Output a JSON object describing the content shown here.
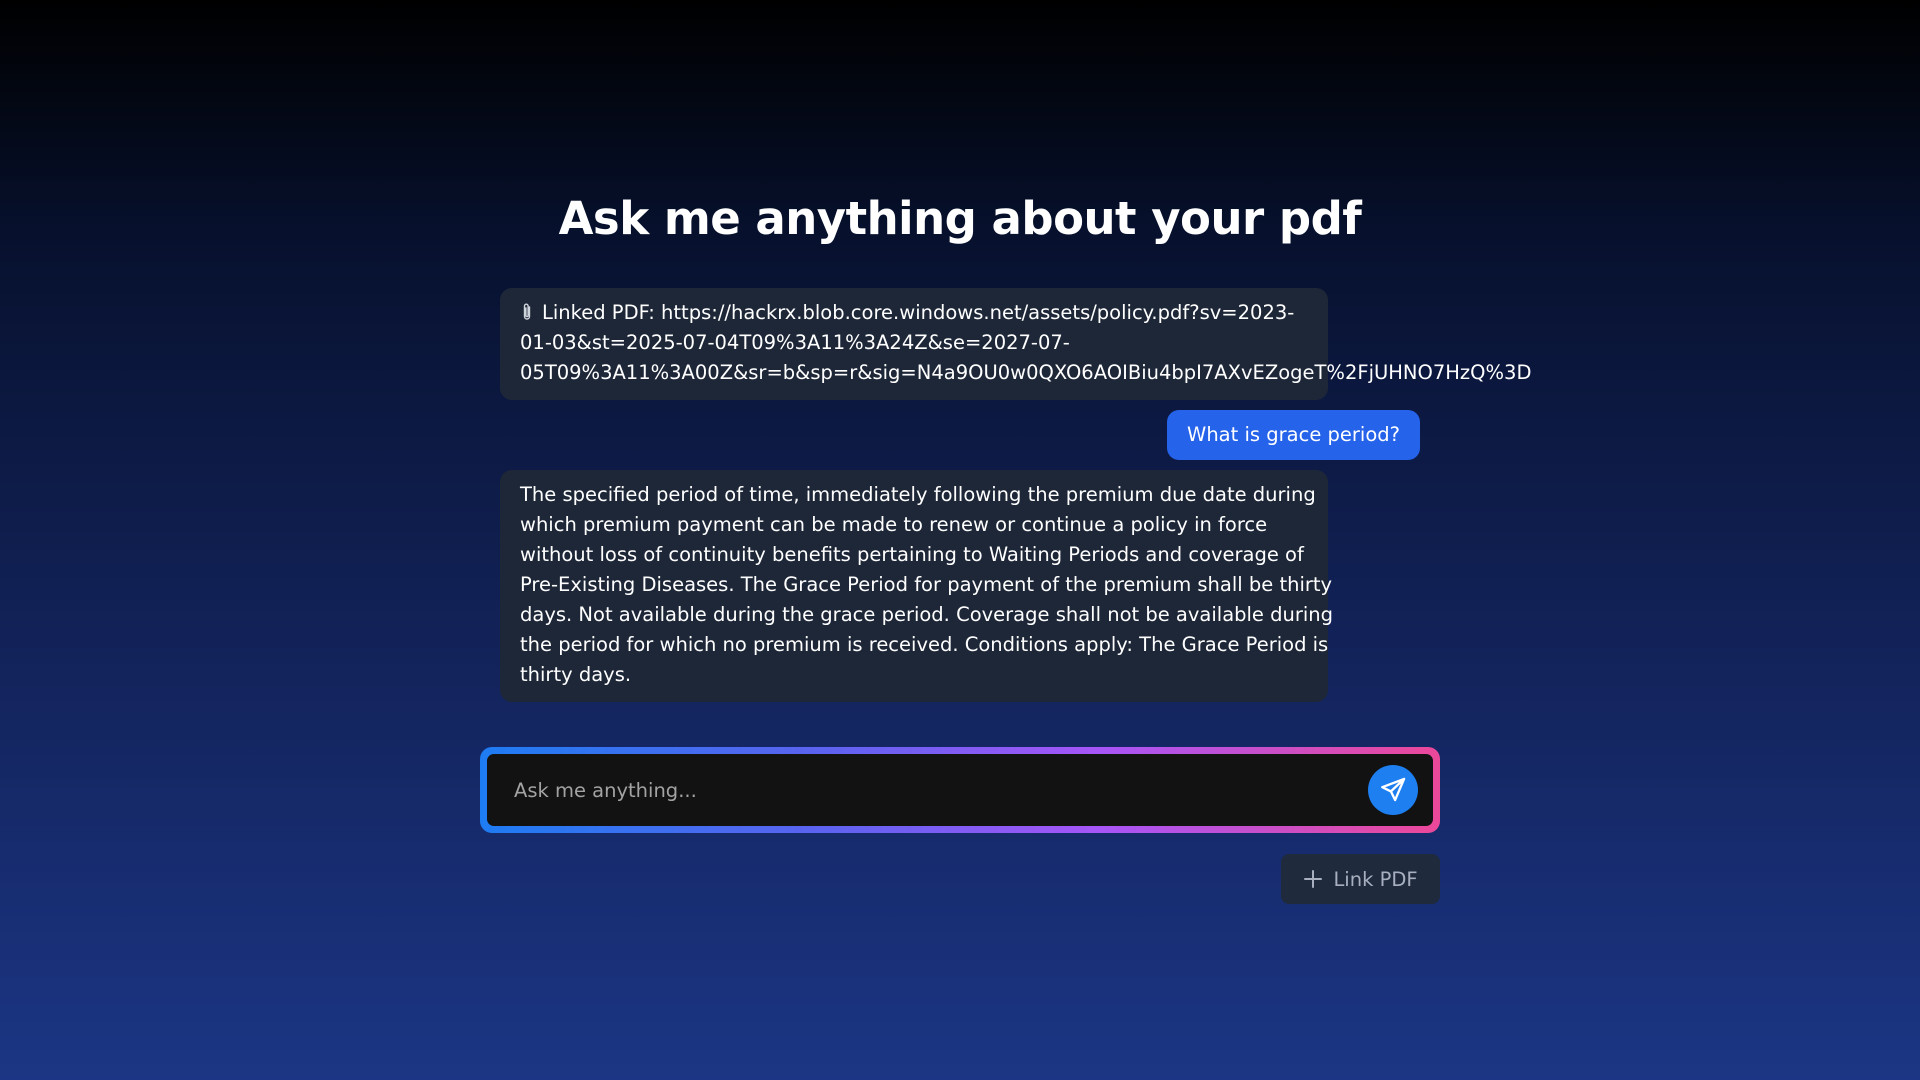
{
  "page": {
    "title": "Ask me anything about your pdf"
  },
  "messages": {
    "linked_pdf": {
      "icon": "paperclip-icon",
      "lines": [
        "Linked PDF: https://hackrx.blob.core.windows.net/assets/policy.pdf?sv=2023-",
        "01-03&st=2025-07-04T09%3A11%3A24Z&se=2027-07-",
        "05T09%3A11%3A00Z&sr=b&sp=r&sig=N4a9OU0w0QXO6AOIBiu4bpI7AXvEZogeT%2FjUHNO7HzQ%3D"
      ]
    },
    "user_question": "What is grace period?",
    "bot_answer_lines": [
      "The specified period of time, immediately following the premium due date during",
      "which premium payment can be made to renew or continue a policy in force",
      "without loss of continuity benefits pertaining to Waiting Periods and coverage of",
      "Pre-Existing Diseases. The Grace Period for payment of the premium shall be thirty",
      "days. Not available during the grace period. Coverage shall not be available during",
      "the period for which no premium is received. Conditions apply: The Grace Period is",
      "thirty days."
    ]
  },
  "input": {
    "placeholder": "Ask me anything...",
    "value": "",
    "send_icon": "send-icon"
  },
  "actions": {
    "link_pdf_label": "Link PDF",
    "link_pdf_icon": "plus-icon"
  },
  "colors": {
    "user_bubble": "#2563eb",
    "bot_bubble": "#1e2738",
    "send_button": "#1d7ff0",
    "input_border_gradient": [
      "#1e7cf2",
      "#a855f7",
      "#ec4899"
    ]
  }
}
